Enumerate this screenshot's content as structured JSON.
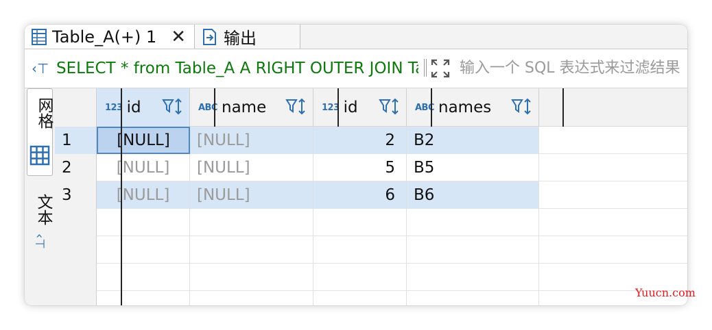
{
  "tabs": [
    {
      "label": "Table_A(+) 1",
      "icon": "table-icon",
      "active": true,
      "close": "✕"
    },
    {
      "label": "输出",
      "icon": "output-icon",
      "active": false
    }
  ],
  "filter": {
    "sql": "SELECT * from Table_A A RIGHT OUTER JOIN Table_B B ON A.id = B.id",
    "placeholder": "输入一个 SQL 表达式来过滤结果 (使用 Ctrl+Space)"
  },
  "side_tabs": {
    "grid": "网格",
    "text": "文本"
  },
  "columns": [
    {
      "type": "123",
      "name": "id"
    },
    {
      "type": "ABC",
      "name": "name"
    },
    {
      "type": "123",
      "name": "id"
    },
    {
      "type": "ABC",
      "name": "names"
    }
  ],
  "rows": [
    {
      "num": "1",
      "id_a": "[NULL]",
      "name": "[NULL]",
      "id_b": "2",
      "names": "B2"
    },
    {
      "num": "2",
      "id_a": "[NULL]",
      "name": "[NULL]",
      "id_b": "5",
      "names": "B5"
    },
    {
      "num": "3",
      "id_a": "[NULL]",
      "name": "[NULL]",
      "id_b": "6",
      "names": "B6"
    }
  ],
  "watermark": "Yuucn.com",
  "colors": {
    "sql_green": "#0b7a0b",
    "accent_blue": "#2d6fb0",
    "null_gray": "#9a9a9a",
    "selected_row": "#d7e6f6",
    "watermark_red": "#e8151b"
  }
}
